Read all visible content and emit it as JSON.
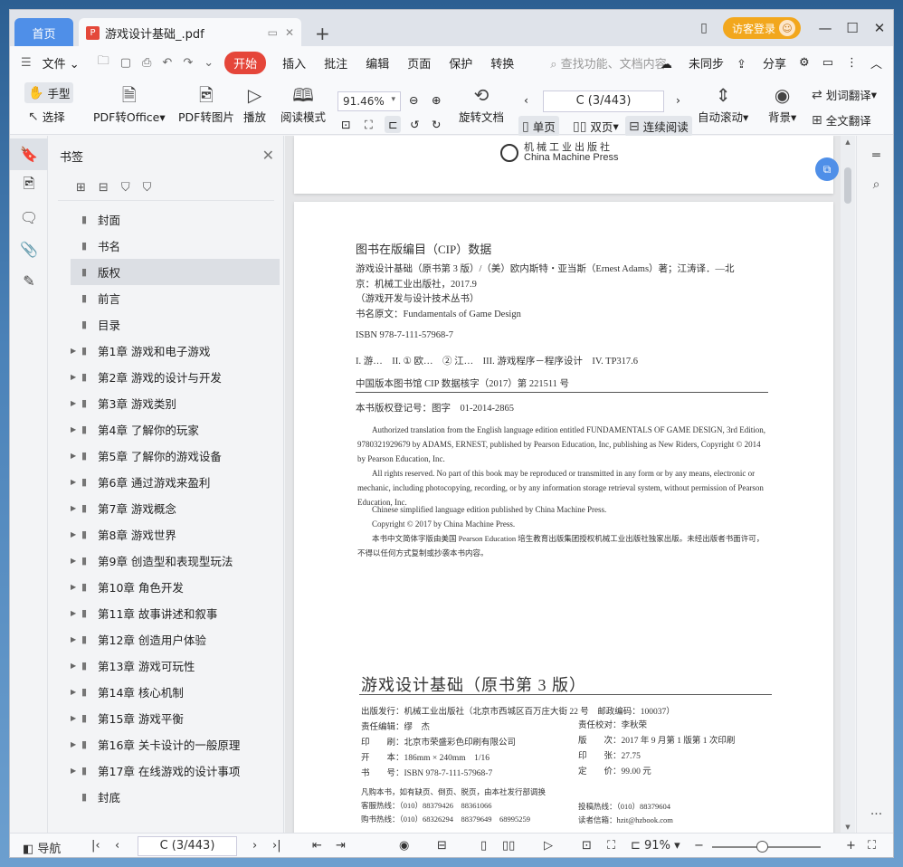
{
  "tabs": {
    "home": "首页",
    "document": "游戏设计基础_.pdf",
    "add": "+"
  },
  "titlebar": {
    "login": "访客登录"
  },
  "menu": {
    "file": "文件",
    "start": "开始",
    "items": [
      "插入",
      "批注",
      "编辑",
      "页面",
      "保护",
      "转换"
    ],
    "search_placeholder": "查找功能、文档内容",
    "sync": "未同步",
    "share": "分享"
  },
  "toolbar": {
    "hand": "手型",
    "select": "选择",
    "pdf_to_office": "PDF转Office",
    "pdf_to_image": "PDF转图片",
    "play": "播放",
    "reading_mode": "阅读模式",
    "zoom": "91.46%",
    "rotate": "旋转文档",
    "page": "C (3/443)",
    "single": "单页",
    "double": "双页",
    "continuous": "连续阅读",
    "auto_scroll": "自动滚动",
    "background": "背景",
    "word_translate": "划词翻译",
    "full_translate": "全文翻译"
  },
  "bookmarks": {
    "title": "书签",
    "items": [
      {
        "label": "封面",
        "expandable": false
      },
      {
        "label": "书名",
        "expandable": false
      },
      {
        "label": "版权",
        "expandable": false,
        "active": true
      },
      {
        "label": "前言",
        "expandable": false
      },
      {
        "label": "目录",
        "expandable": false
      },
      {
        "label": "第1章 游戏和电子游戏",
        "expandable": true
      },
      {
        "label": "第2章 游戏的设计与开发",
        "expandable": true
      },
      {
        "label": "第3章 游戏类别",
        "expandable": true
      },
      {
        "label": "第4章 了解你的玩家",
        "expandable": true
      },
      {
        "label": "第5章 了解你的游戏设备",
        "expandable": true
      },
      {
        "label": "第6章 通过游戏来盈利",
        "expandable": true
      },
      {
        "label": "第7章 游戏概念",
        "expandable": true
      },
      {
        "label": "第8章 游戏世界",
        "expandable": true
      },
      {
        "label": "第9章 创造型和表现型玩法",
        "expandable": true
      },
      {
        "label": "第10章 角色开发",
        "expandable": true
      },
      {
        "label": "第11章 故事讲述和叙事",
        "expandable": true
      },
      {
        "label": "第12章 创造用户体验",
        "expandable": true
      },
      {
        "label": "第13章 游戏可玩性",
        "expandable": true
      },
      {
        "label": "第14章 核心机制",
        "expandable": true
      },
      {
        "label": "第15章 游戏平衡",
        "expandable": true
      },
      {
        "label": "第16章 关卡设计的一般原理",
        "expandable": true
      },
      {
        "label": "第17章 在线游戏的设计事项",
        "expandable": true
      },
      {
        "label": "封底",
        "expandable": false
      }
    ]
  },
  "document": {
    "publisher_cn": "机械工业出版社",
    "publisher_en": "China Machine Press",
    "cip_title": "图书在版编目（CIP）数据",
    "cip_lines": [
      "游戏设计基础（原书第 3 版）/（美）欧内斯特・亚当斯（Ernest Adams）著；江涛译．—北",
      "京：机械工业出版社，2017.9",
      "（游戏开发与设计技术丛书）",
      "书名原文：Fundamentals of Game Design"
    ],
    "isbn": "ISBN 978-7-111-57968-7",
    "classification": "I. 游…　II. ① 欧…　② 江…　III. 游戏程序－程序设计　IV. TP317.6",
    "cip_number": "中国版本图书馆 CIP 数据核字（2017）第 221511 号",
    "copyright_reg": "本书版权登记号：图字　01-2014-2865",
    "english_paragraphs": [
      "Authorized translation from the English language edition entitled FUNDAMENTALS OF GAME DESIGN, 3rd Edition, 9780321929679 by ADAMS, ERNEST, published by Pearson Education, Inc, publishing as New Riders, Copyright © 2014 by Pearson Education, Inc.",
      "All rights reserved. No part of this book may be reproduced or transmitted in any form or by any means, electronic or mechanic, including photocopying, recording, or by any information storage retrieval system, without permission of Pearson Education, Inc.",
      "Chinese simplified language edition published by China Machine Press.",
      "Copyright © 2017 by China Machine Press.",
      "本书中文简体字版由美国 Pearson Education 培生教育出版集团授权机械工业出版社独家出版。未经出版者书面许可，不得以任何方式复制或抄袭本书内容。"
    ],
    "book_title": "游戏设计基础（原书第 3 版）",
    "imprint_left": [
      "出版发行：机械工业出版社（北京市西城区百万庄大街 22 号　邮政编码：100037）",
      "责任编辑：缪　杰",
      "印　　刷：北京市荣盛彩色印刷有限公司",
      "开　　本：186mm × 240mm　1/16",
      "书　　号：ISBN 978-7-111-57968-7"
    ],
    "imprint_right": [
      "责任校对：李秋荣",
      "版　　次：2017 年 9 月第 1 版第 1 次印刷",
      "印　　张：27.75",
      "定　　价：99.00 元"
    ],
    "footer_left": [
      "凡购本书，如有缺页、倒页、脱页，由本社发行部调换",
      "客服热线：（010）88379426　88361066",
      "购书热线：（010）68326294　88379649　68995259"
    ],
    "footer_right": [
      "投稿热线：（010）88379604",
      "读者信箱：hzit@hzbook.com"
    ]
  },
  "statusbar": {
    "nav": "导航",
    "page": "C (3/443)",
    "zoom": "91%",
    "zoom_fraction": 0.46
  }
}
